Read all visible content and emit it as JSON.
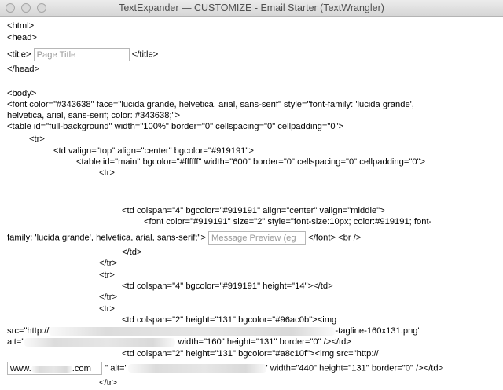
{
  "window": {
    "title": "TextExpander — CUSTOMIZE - Email Starter (TextWrangler)"
  },
  "code": {
    "l1": "<html>",
    "l2": "<head>",
    "l3a": "<title>",
    "title_field_placeholder": "Page Title",
    "l3b": "</title>",
    "l4": "</head>",
    "l5": "<body>",
    "l6": "<font color=\"#343638\" face=\"lucida grande, helvetica, arial, sans-serif\" style=\"font-family: 'lucida grande',",
    "l7": "helvetica, arial, sans-serif; color: #343638;\">",
    "l8": "<table id=\"full-background\" width=\"100%\" border=\"0\" cellspacing=\"0\" cellpadding=\"0\">",
    "l9": "<tr>",
    "l10": "<td valign=\"top\" align=\"center\" bgcolor=\"#919191\">",
    "l11": "<table id=\"main\" bgcolor=\"#ffffff\" width=\"600\" border=\"0\" cellspacing=\"0\" cellpadding=\"0\">",
    "l12": "<tr>",
    "l13": "<td colspan=\"4\" bgcolor=\"#919191\" align=\"center\" valign=\"middle\">",
    "l14": "<font color=\"#919191\" size=\"2\" style=\"font-size:10px; color:#919191; font-",
    "l15a": "family: 'lucida grande', helvetica, arial, sans-serif;\">",
    "message_field_placeholder": "Message Preview (eg",
    "l15b": "</font> <br />",
    "l16": "</td>",
    "l17": "</tr>",
    "l18": "<tr>",
    "l19": "<td colspan=\"4\" bgcolor=\"#919191\" height=\"14\"></td>",
    "l20": "</tr>",
    "l21": "<tr>",
    "l22": "<td colspan=\"2\" height=\"131\" bgcolor=\"#96ac0b\"><img",
    "l23a": "src=\"http://",
    "l23b": "-tagline-160x131.png\"",
    "l24a": "alt=\"",
    "l24b": "width=\"160\" height=\"131\" border=\"0\" /></td>",
    "l25": "<td colspan=\"2\" height=\"131\" bgcolor=\"#a8c10f\"><img src=\"http://",
    "url_field_value": "www.",
    "url_field_tail": ".com",
    "l26a": "\" alt=\"",
    "l26b": "' width=\"440\" height=\"131\" border=\"0\" /></td>",
    "l27": "</tr>"
  }
}
